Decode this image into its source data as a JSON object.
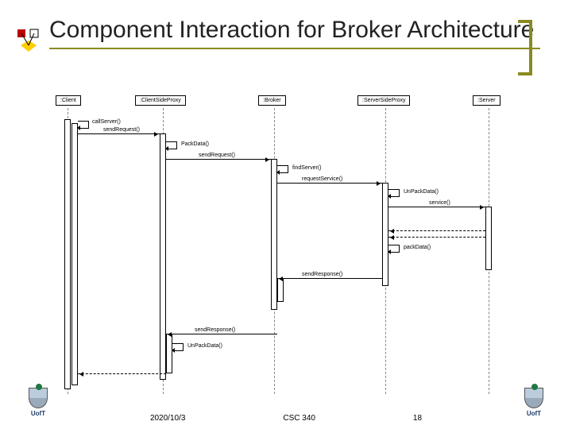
{
  "title": "Component Interaction for Broker Architecture",
  "lifelines": {
    "client": ":Client",
    "clientProxy": ":ClientSideProxy",
    "broker": ":Broker",
    "serverProxy": ":ServerSideProxy",
    "server": ":Server"
  },
  "messages": {
    "callServer": "callServer()",
    "sendRequest1": "sendRequest()",
    "packData1": "PackData()",
    "sendRequest2": "sendRequest()",
    "findServer": "findServer()",
    "requestService": "requestService()",
    "unpackData1": "UnPackData()",
    "service": "service()",
    "packData2": "packData()",
    "sendResponse1": "sendResponse()",
    "sendResponse2": "sendResponse()",
    "unpackData2": "UnPackData()"
  },
  "footer": {
    "date": "2020/10/3",
    "course": "CSC 340",
    "page": "18",
    "org": "UofT"
  }
}
